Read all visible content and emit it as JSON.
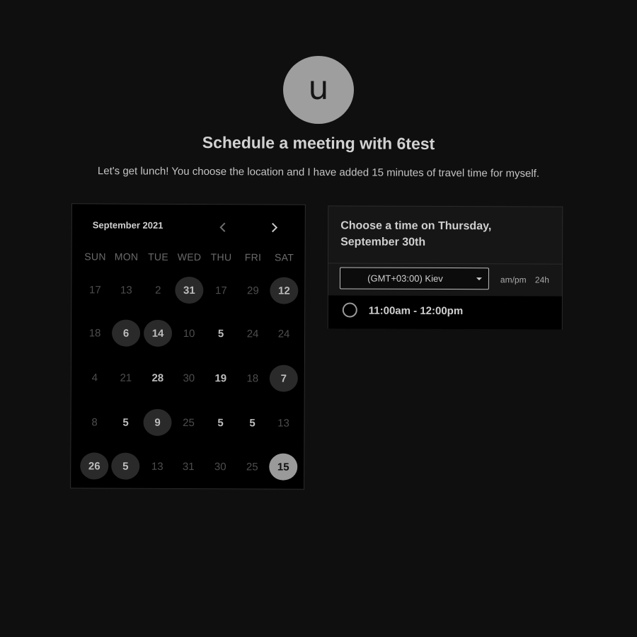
{
  "avatar": {
    "initial": "u"
  },
  "header": {
    "title": "Schedule a meeting with 6test",
    "description": "Let's get lunch! You choose the location and I have added 15 minutes of travel time for myself."
  },
  "calendar": {
    "month_label": "September 2021",
    "prev_icon": "chevron-left-icon",
    "next_icon": "chevron-right-icon",
    "weekdays": [
      "SUN",
      "MON",
      "TUE",
      "WED",
      "THU",
      "FRI",
      "SAT"
    ],
    "weeks": [
      [
        {
          "label": "17",
          "available": false
        },
        {
          "label": "13",
          "available": false
        },
        {
          "label": "2",
          "available": false
        },
        {
          "label": "31",
          "available": true,
          "bubble": true
        },
        {
          "label": "17",
          "available": false
        },
        {
          "label": "29",
          "available": false
        },
        {
          "label": "12",
          "available": true,
          "bubble": true
        }
      ],
      [
        {
          "label": "18",
          "available": false
        },
        {
          "label": "6",
          "available": true,
          "bubble": true
        },
        {
          "label": "14",
          "available": true,
          "bubble": true
        },
        {
          "label": "10",
          "available": false
        },
        {
          "label": "5",
          "available": true,
          "bubble": false
        },
        {
          "label": "24",
          "available": false
        },
        {
          "label": "24",
          "available": false
        }
      ],
      [
        {
          "label": "4",
          "available": false
        },
        {
          "label": "21",
          "available": false
        },
        {
          "label": "28",
          "available": true,
          "bubble": false
        },
        {
          "label": "30",
          "available": false
        },
        {
          "label": "19",
          "available": true,
          "bubble": false
        },
        {
          "label": "18",
          "available": false
        },
        {
          "label": "7",
          "available": true,
          "bubble": true
        }
      ],
      [
        {
          "label": "8",
          "available": false
        },
        {
          "label": "5",
          "available": true,
          "bubble": false
        },
        {
          "label": "9",
          "available": true,
          "bubble": true
        },
        {
          "label": "25",
          "available": false
        },
        {
          "label": "5",
          "available": true,
          "bubble": false
        },
        {
          "label": "5",
          "available": true,
          "bubble": false
        },
        {
          "label": "13",
          "available": false
        }
      ],
      [
        {
          "label": "26",
          "available": true,
          "bubble": true
        },
        {
          "label": "5",
          "available": true,
          "bubble": true
        },
        {
          "label": "13",
          "available": false
        },
        {
          "label": "31",
          "available": false
        },
        {
          "label": "30",
          "available": false
        },
        {
          "label": "25",
          "available": false
        },
        {
          "label": "15",
          "available": true,
          "selected": true
        }
      ]
    ]
  },
  "time_panel": {
    "heading": "Choose a time on Thursday, September 30th",
    "timezone": "(GMT+03:00) Kiev",
    "format_ampm": "am/pm",
    "format_24h": "24h",
    "slots": [
      "11:00am - 12:00pm"
    ]
  },
  "colors": {
    "background": "#0f0f0f",
    "avatar": "#9e9e9e",
    "selected_day": "#9a9a9a",
    "day_bubble": "#2a2a2a"
  }
}
